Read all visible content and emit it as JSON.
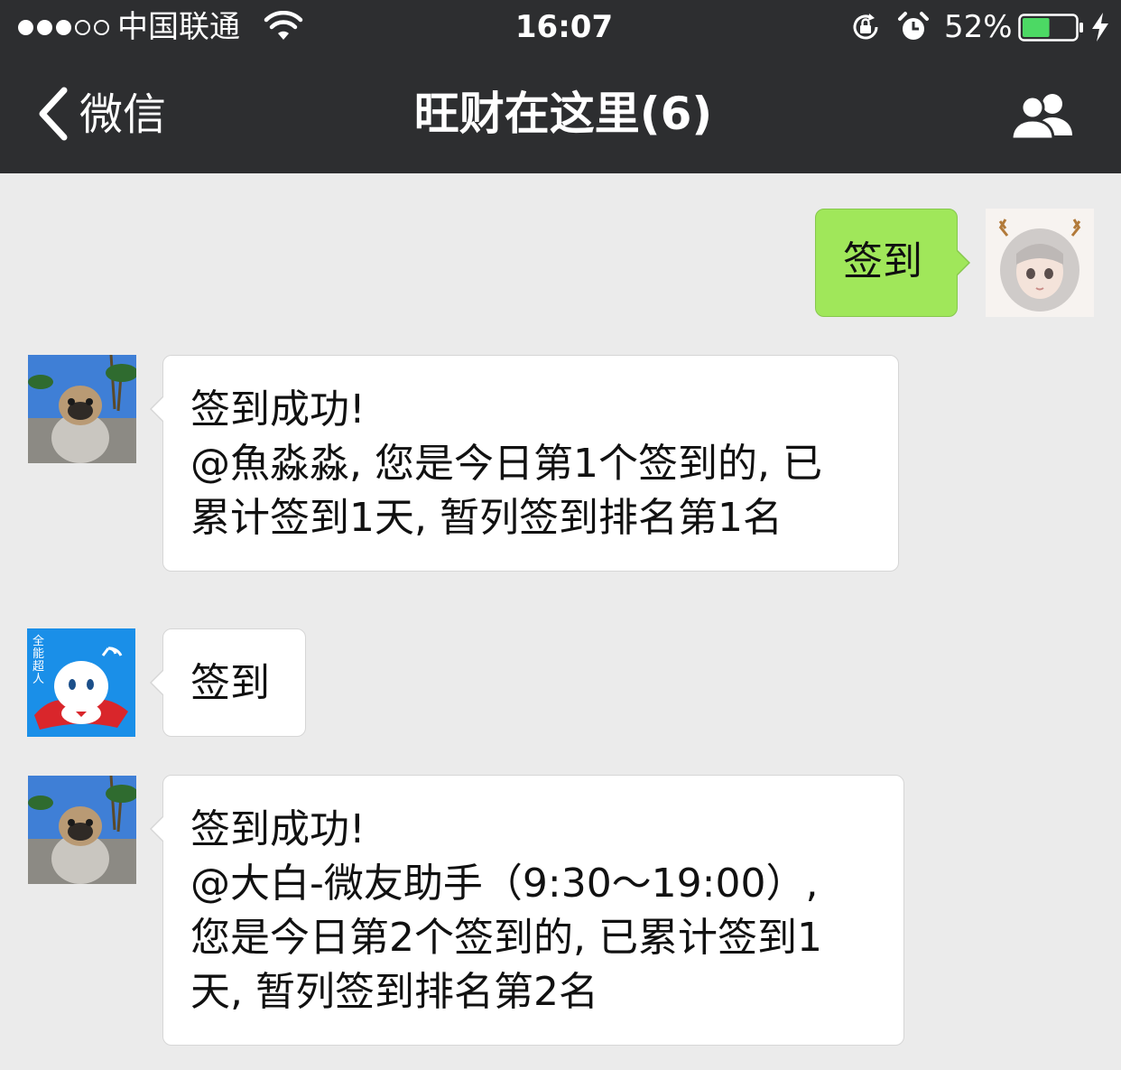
{
  "status_bar": {
    "carrier": "中国联通",
    "time": "16:07",
    "battery_percent": "52%",
    "battery_level": 0.52,
    "signal_strength": 3,
    "signal_max": 5,
    "icons": [
      "wifi-icon",
      "rotation-lock-icon",
      "alarm-icon",
      "battery-icon",
      "charging-bolt-icon"
    ]
  },
  "nav": {
    "back_label": "微信",
    "title": "旺财在这里(6)",
    "icons": [
      "chevron-left-icon",
      "group-members-icon"
    ]
  },
  "colors": {
    "header_bg": "#2d2e30",
    "chat_bg": "#ebebeb",
    "sent_bubble": "#a0e75a",
    "received_bubble": "#ffffff",
    "battery_fill": "#4cd964"
  },
  "messages": [
    {
      "direction": "sent",
      "avatar": "anime-girl-avatar",
      "lines": [
        "签到"
      ]
    },
    {
      "direction": "received",
      "avatar": "pug-avatar",
      "lines": [
        "签到成功!",
        "@魚淼淼, 您是今日第1个签到的, 已",
        "累计签到1天, 暂列签到排名第1名"
      ]
    },
    {
      "direction": "received",
      "avatar": "robot-avatar",
      "avatar_text": "全能超人",
      "lines": [
        "签到"
      ]
    },
    {
      "direction": "received",
      "avatar": "pug-avatar",
      "lines": [
        "签到成功!",
        "@大白-微友助手（9:30～19:00）,",
        "您是今日第2个签到的, 已累计签到1",
        "天, 暂列签到排名第2名"
      ]
    }
  ]
}
